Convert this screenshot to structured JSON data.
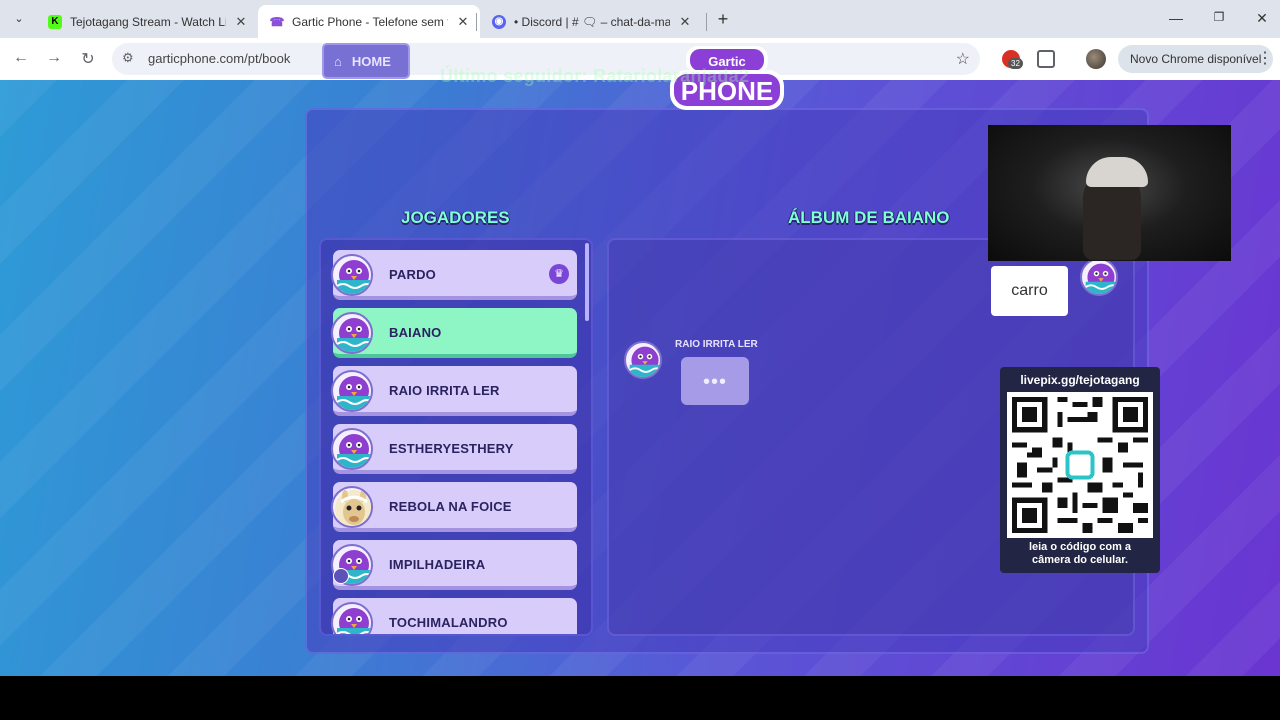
{
  "browser": {
    "tabs": [
      {
        "title": "Tejotagang Stream - Watch Live",
        "favicon": "kick-icon",
        "favicon_color": "#53fc18",
        "active": false
      },
      {
        "title": "Gartic Phone - Telefone sem fio",
        "favicon": "phone-icon",
        "favicon_color": "#8a4fd8",
        "active": true
      },
      {
        "title": "• Discord | # 🗨 – chat-da-mala",
        "favicon": "discord-icon",
        "favicon_color": "#5865f2",
        "active": false
      }
    ],
    "url": "garticphone.com/pt/book",
    "extension_badge": "32",
    "update_button": "Novo Chrome disponível"
  },
  "stream_overlay": {
    "last_follower": "Último seguidor: Ratariolaranjada2",
    "qr_url": "livepix.gg/tejotagang",
    "qr_caption_line1": "leia o código com a",
    "qr_caption_line2": "câmera do celular."
  },
  "game": {
    "home_label": "HOME",
    "logo_top": "Gartic",
    "logo_bottom": "PHONE",
    "players_title": "JOGADORES",
    "album_title": "ÁLBUM DE BAIANO",
    "players": [
      {
        "name": "PARDO",
        "host": true
      },
      {
        "name": "BAIANO",
        "highlight": true
      },
      {
        "name": "RAIO IRRITA LER"
      },
      {
        "name": "ESTHERYESTHERY"
      },
      {
        "name": "REBOLA NA FOICE",
        "avatar": "llama"
      },
      {
        "name": "IMPILHADEIRA",
        "badge": true
      },
      {
        "name": "TOCHIMALANDRO"
      }
    ],
    "album": {
      "author": "RAIO IRRITA LER",
      "typing_indicator": "•••",
      "answer": "carro"
    }
  },
  "colors": {
    "accent_title": "#7effd4",
    "player_card": "#d8cdfa",
    "player_highlight": "#8ef5c4"
  }
}
